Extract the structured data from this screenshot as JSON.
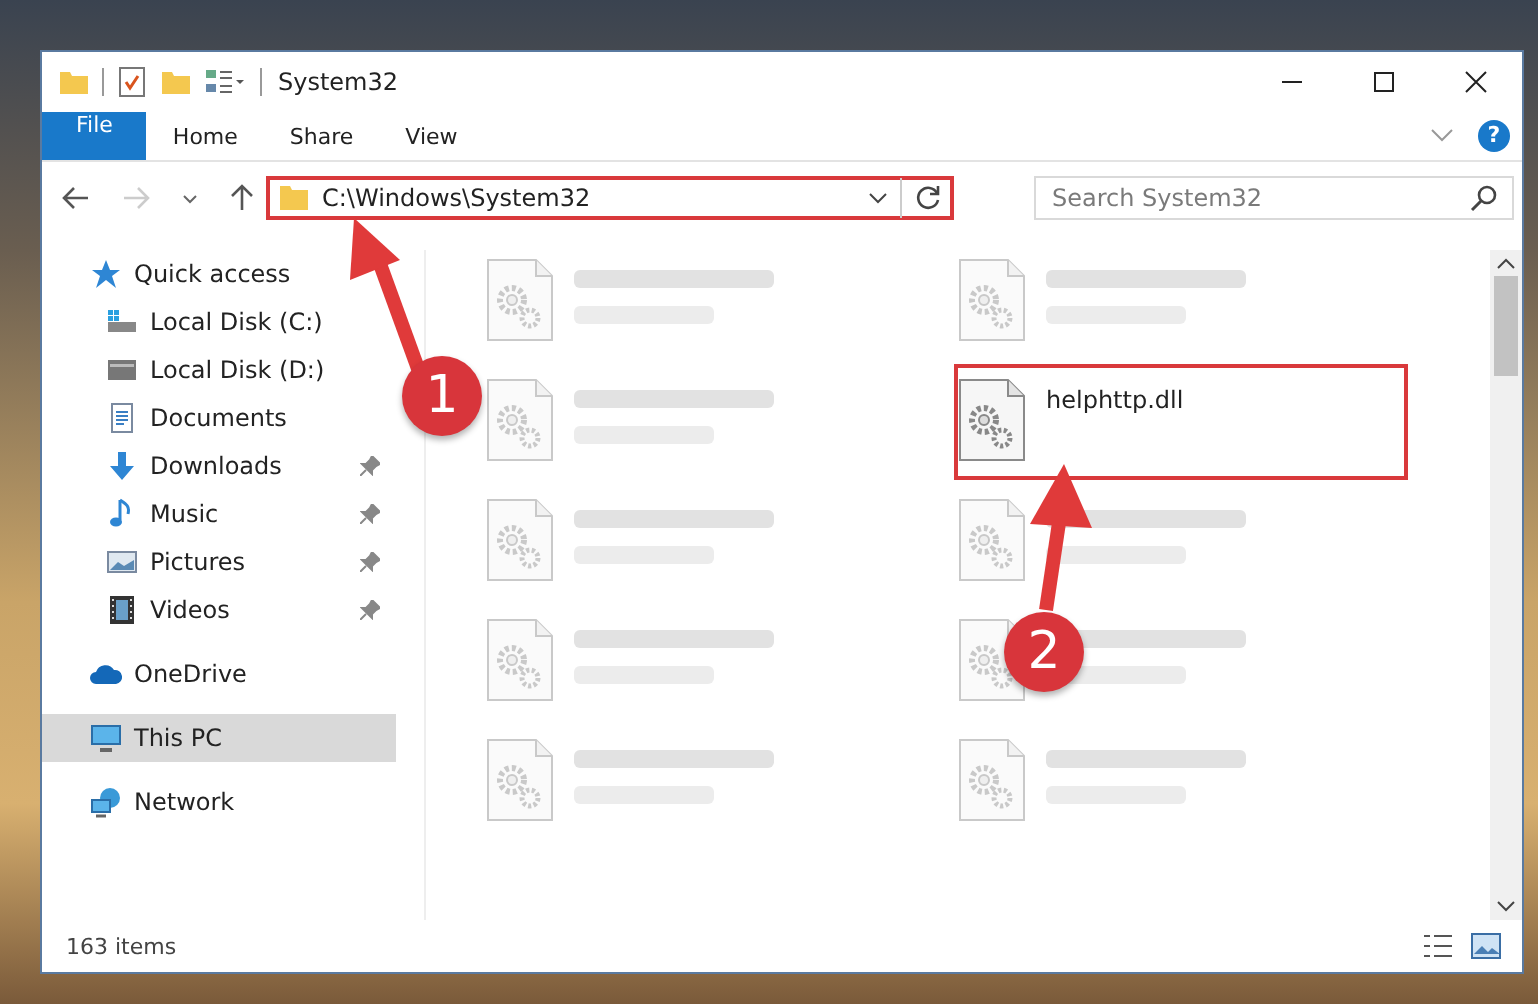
{
  "window": {
    "title": "System32"
  },
  "ribbon": {
    "tabs": [
      {
        "label": "File",
        "kind": "file",
        "selected": false
      },
      {
        "label": "Home",
        "kind": "tab",
        "selected": false
      },
      {
        "label": "Share",
        "kind": "tab",
        "selected": false
      },
      {
        "label": "View",
        "kind": "tab",
        "selected": false
      }
    ],
    "help": {
      "label": "?"
    }
  },
  "address": {
    "path": "C:\\Windows\\System32"
  },
  "search": {
    "placeholder": "Search System32"
  },
  "sidebar": {
    "items": [
      {
        "label": "Quick access",
        "kind": "star",
        "selected": false,
        "children": [
          {
            "label": "Local Disk (C:)",
            "kind": "drive-c",
            "selected": false,
            "pinned": false
          },
          {
            "label": "Local Disk (D:)",
            "kind": "drive",
            "selected": false,
            "pinned": false
          },
          {
            "label": "Documents",
            "kind": "documents",
            "selected": false,
            "pinned": false
          },
          {
            "label": "Downloads",
            "kind": "downloads",
            "selected": false,
            "pinned": true
          },
          {
            "label": "Music",
            "kind": "music",
            "selected": false,
            "pinned": true
          },
          {
            "label": "Pictures",
            "kind": "pictures",
            "selected": false,
            "pinned": true
          },
          {
            "label": "Videos",
            "kind": "videos",
            "selected": false,
            "pinned": true
          }
        ]
      },
      {
        "label": "OneDrive",
        "kind": "cloud",
        "selected": false
      },
      {
        "label": "This PC",
        "kind": "pc",
        "selected": true
      },
      {
        "label": "Network",
        "kind": "network",
        "selected": false
      }
    ]
  },
  "files": [
    {
      "blurred": true
    },
    {
      "blurred": true
    },
    {
      "blurred": true
    },
    {
      "name": "helphttp.dll",
      "blurred": false
    },
    {
      "blurred": true
    },
    {
      "blurred": true
    },
    {
      "blurred": true
    },
    {
      "blurred": true
    },
    {
      "blurred": true
    },
    {
      "blurred": true
    }
  ],
  "status_bar": {
    "item_count": "163 items"
  },
  "annotations": [
    {
      "number": "1"
    },
    {
      "number": "2"
    }
  ]
}
